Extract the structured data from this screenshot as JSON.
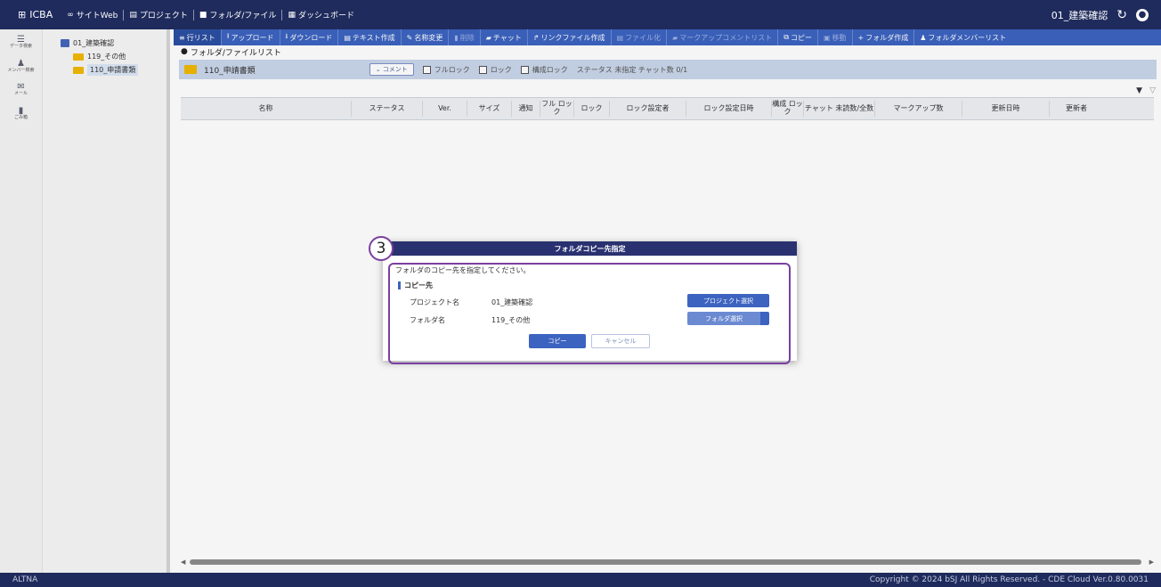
{
  "topbar": {
    "app_name": "ICBA",
    "nav": [
      "サイトWeb",
      "プロジェクト",
      "フォルダ/ファイル",
      "ダッシュボード"
    ],
    "project": "01_建築確認",
    "reload_icon": "reload-icon",
    "user_icon": "user-icon"
  },
  "rail": [
    {
      "label": "データ検索",
      "icon": "data-search-icon"
    },
    {
      "label": "メンバー検索",
      "icon": "member-search-icon"
    },
    {
      "label": "メール",
      "icon": "mail-icon"
    },
    {
      "label": "ごみ箱",
      "icon": "trash-icon"
    }
  ],
  "tree": {
    "root": "01_建築確認",
    "children": [
      "119_その他",
      "110_申請書類"
    ]
  },
  "toolbar": [
    "行リスト",
    "アップロード",
    "ダウンロード",
    "テキスト作成",
    "名称変更",
    "削除",
    "チャット",
    "リンクファイル作成",
    "ファイル化",
    "マークアップコメントリスト",
    "コピー",
    "移動",
    "フォルダ作成",
    "フォルダメンバーリスト"
  ],
  "breadcrumb": "フォルダ/ファイルリスト",
  "folderbar": {
    "name": "110_申請書類",
    "comment_btn": "コメント",
    "checks": [
      "フルロック",
      "ロック",
      "構成ロック"
    ],
    "status": "ステータス 未指定  チャット数 0/1"
  },
  "columns": [
    "名称",
    "ステータス",
    "Ver.",
    "サイズ",
    "通知",
    "フル ロック",
    "ロック",
    "ロック設定者",
    "ロック設定日時",
    "構成 ロック",
    "チャット 未読数/全数",
    "マークアップ数",
    "更新日時",
    "更新者"
  ],
  "dialog": {
    "title": "フォルダコピー先指定",
    "badge": "3",
    "message": "フォルダのコピー先を指定してください。",
    "section": "コピー先",
    "project_label": "プロジェクト名",
    "project_value": "01_建築確認",
    "folder_label": "フォルダ名",
    "folder_value": "119_その他",
    "project_btn": "プロジェクト選択",
    "folder_btn": "フォルダ選択",
    "copy_btn": "コピー",
    "cancel_btn": "キャンセル"
  },
  "footer": {
    "left": "ALTNA",
    "right": "Copyright © 2024 bSJ All Rights Reserved. - CDE Cloud Ver.0.80.0031"
  }
}
